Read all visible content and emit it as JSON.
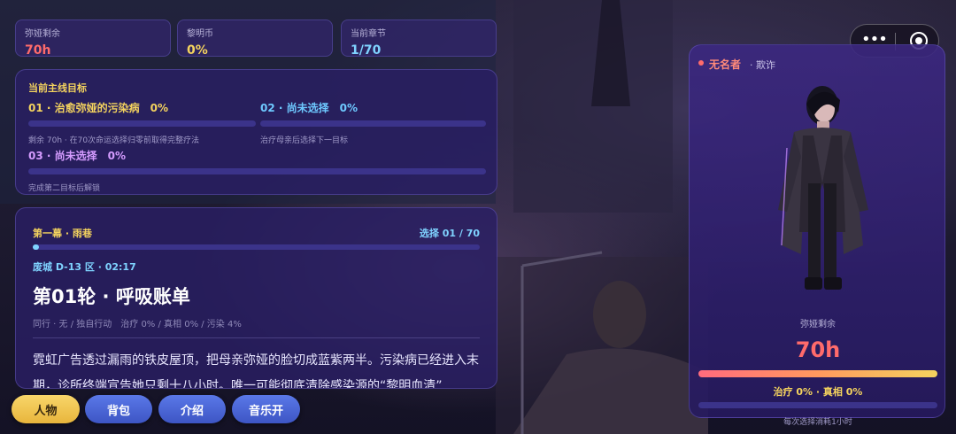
{
  "stats": [
    {
      "label": "弥娅剩余",
      "value": "70h",
      "color": "#ff6b6b"
    },
    {
      "label": "黎明币",
      "value": "0%",
      "color": "#f4d35e"
    },
    {
      "label": "当前章节",
      "value": "1/70",
      "color": "#7fd3ff"
    }
  ],
  "objectives": {
    "title": "当前主线目标",
    "items": [
      {
        "head": "01 · 治愈弥娅的污染病　0%",
        "sub": "剩余 70h · 在70次命运选择归零前取得完整疗法",
        "progress": 0,
        "color": "#f4d35e"
      },
      {
        "head": "02 · 尚未选择　0%",
        "sub": "治疗母亲后选择下一目标",
        "progress": 0,
        "color": "#6ec9ff"
      },
      {
        "head": "03 · 尚未选择　0%",
        "sub": "完成第二目标后解锁",
        "progress": 0,
        "color": "#d59cff"
      }
    ]
  },
  "story": {
    "act": "第一幕 · 雨巷",
    "choice": "选择 01 / 70",
    "choice_progress": 0.014,
    "location": "废城 D-13 区 · 02:17",
    "title": "第01轮 · 呼吸账单",
    "meta": "同行 · 无 / 独自行动　治疗 0% / 真相 0% / 污染 4%",
    "paragraph": "霓虹广告透过漏雨的铁皮屋顶，把母亲弥娅的脸切成蓝紫两半。污染病已经进入末期，诊所终端宣告她只剩十八小时。唯一可能彻底清除感染源的“黎明血清”"
  },
  "character": {
    "name": "无名者",
    "trait": "· 欺诈",
    "remaining_label": "弥娅剩余",
    "remaining_value": "70h",
    "remaining_fraction": 1.0,
    "stats_line": "治疗 0% · 真相 0%",
    "stats_progress": 0,
    "footer": "每次选择消耗1小时"
  },
  "bottom_nav": [
    {
      "label": "人物",
      "active": true
    },
    {
      "label": "背包",
      "active": false
    },
    {
      "label": "介绍",
      "active": false
    },
    {
      "label": "音乐开",
      "active": false
    }
  ],
  "capsule": {
    "more_icon": "more-dots-icon",
    "close_icon": "target-circle-icon"
  }
}
